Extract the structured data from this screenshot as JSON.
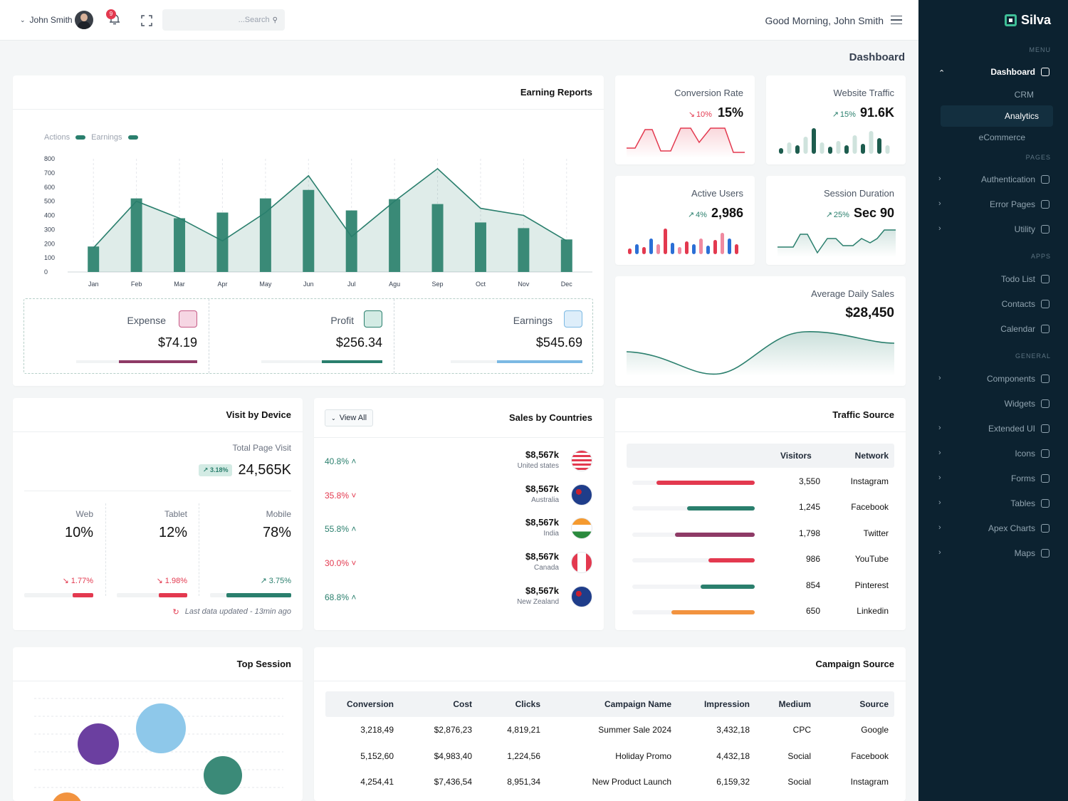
{
  "topbar": {
    "user": "John Smith",
    "notif_count": "9",
    "search_placeholder": "...Search",
    "greeting": "Good Morning, John Smith"
  },
  "page_title": "Dashboard",
  "sidebar": {
    "brand": "Silva",
    "sec_menu": "MENU",
    "sec_pages": "PAGES",
    "sec_apps": "APPS",
    "sec_general": "GENERAL",
    "dashboard": "Dashboard",
    "crm": "CRM",
    "analytics": "Analytics",
    "ecommerce": "eCommerce",
    "pages": [
      "Authentication",
      "Error Pages",
      "Utility"
    ],
    "apps": [
      "Todo List",
      "Contacts",
      "Calendar"
    ],
    "general": [
      "Components",
      "Widgets",
      "Extended UI",
      "Icons",
      "Forms",
      "Tables",
      "Apex Charts",
      "Maps"
    ]
  },
  "earning": {
    "title": "Earning Reports",
    "legend_actions": "Actions",
    "legend_earnings": "Earnings",
    "expense_label": "Expense",
    "expense_value": "$74.19",
    "profit_label": "Profit",
    "profit_value": "$256.34",
    "earnings_label": "Earnings",
    "earnings_value": "$545.69",
    "expense_fill": 0.65,
    "profit_fill": 0.5,
    "earnings_fill": 0.65
  },
  "chart_data": {
    "type": "bar",
    "categories": [
      "Jan",
      "Feb",
      "Mar",
      "Apr",
      "May",
      "Jun",
      "Jul",
      "Agu",
      "Sep",
      "Oct",
      "Nov",
      "Dec"
    ],
    "series": [
      {
        "name": "Actions",
        "type": "bar",
        "values": [
          180,
          520,
          380,
          420,
          520,
          580,
          435,
          515,
          480,
          350,
          310,
          230
        ]
      },
      {
        "name": "Earnings",
        "type": "area",
        "values": [
          170,
          500,
          380,
          220,
          420,
          680,
          250,
          500,
          730,
          450,
          400,
          220
        ]
      }
    ],
    "ylim": [
      0,
      800
    ],
    "yticks": [
      "800",
      "700",
      "600",
      "500",
      "400",
      "300",
      "200",
      "100",
      "0"
    ]
  },
  "kpis": {
    "conv": {
      "title": "Conversion Rate",
      "pct": "10%",
      "value": "15%"
    },
    "traffic": {
      "title": "Website Traffic",
      "pct": "15%",
      "value": "91.6K"
    },
    "active": {
      "title": "Active Users",
      "pct": "4%",
      "value": "2,986"
    },
    "session": {
      "title": "Session Duration",
      "pct": "25%",
      "value": "Sec 90"
    },
    "avg": {
      "title": "Average Daily Sales",
      "value": "$28,450"
    }
  },
  "device": {
    "title": "Visit by Device",
    "total_label": "Total Page Visit",
    "badge": "3.18%",
    "total": "24,565K",
    "cols": [
      {
        "label": "Web",
        "value": "10%",
        "delta": "1.77%"
      },
      {
        "label": "Tablet",
        "value": "12%",
        "delta": "1.98%"
      },
      {
        "label": "Mobile",
        "value": "78%",
        "delta": "3.75%"
      }
    ],
    "updated": "Last data updated - 13min ago"
  },
  "countries": {
    "title": "Sales by Countries",
    "view_all": "View All",
    "rows": [
      {
        "pct": "40.8%",
        "amount": "$8,567k",
        "name": "United states",
        "dir": "up"
      },
      {
        "pct": "35.8%",
        "amount": "$8,567k",
        "name": "Australia",
        "dir": "down"
      },
      {
        "pct": "55.8%",
        "amount": "$8,567k",
        "name": "India",
        "dir": "up"
      },
      {
        "pct": "30.0%",
        "amount": "$8,567k",
        "name": "Canada",
        "dir": "down"
      },
      {
        "pct": "68.8%",
        "amount": "$8,567k",
        "name": "New Zealand",
        "dir": "up"
      }
    ]
  },
  "traffic": {
    "title": "Traffic Source",
    "h_visitors": "Visitors",
    "h_network": "Network",
    "rows": [
      {
        "visitors": "3,550",
        "network": "Instagram",
        "color": "#e3394f",
        "frac": 0.8
      },
      {
        "visitors": "1,245",
        "network": "Facebook",
        "color": "#2a7f6d",
        "frac": 0.55
      },
      {
        "visitors": "1,798",
        "network": "Twitter",
        "color": "#8e3a66",
        "frac": 0.65
      },
      {
        "visitors": "986",
        "network": "YouTube",
        "color": "#e3394f",
        "frac": 0.38
      },
      {
        "visitors": "854",
        "network": "Pinterest",
        "color": "#2a7f6d",
        "frac": 0.44
      },
      {
        "visitors": "650",
        "network": "Linkedin",
        "color": "#f2933f",
        "frac": 0.68
      }
    ]
  },
  "session": {
    "title": "Top Session"
  },
  "campaign": {
    "title": "Campaign Source",
    "headers": [
      "Conversion",
      "Cost",
      "Clicks",
      "Campaign Name",
      "Impression",
      "Medium",
      "Source"
    ],
    "rows": [
      [
        "3,218,49",
        "$2,876,23",
        "4,819,21",
        "Summer Sale 2024",
        "3,432,18",
        "CPC",
        "Google"
      ],
      [
        "5,152,60",
        "$4,983,40",
        "1,224,56",
        "Holiday Promo",
        "4,432,18",
        "Social",
        "Facebook"
      ],
      [
        "4,254,41",
        "$7,436,54",
        "8,951,34",
        "New Product Launch",
        "6,159,32",
        "Social",
        "Instagram"
      ]
    ]
  },
  "colors": {
    "accent": "#2a7f6d",
    "red": "#e3394f",
    "purple": "#8e3a66",
    "blue": "#7cb9e3",
    "orange": "#f2933f",
    "sidebar": "#0c2230"
  }
}
